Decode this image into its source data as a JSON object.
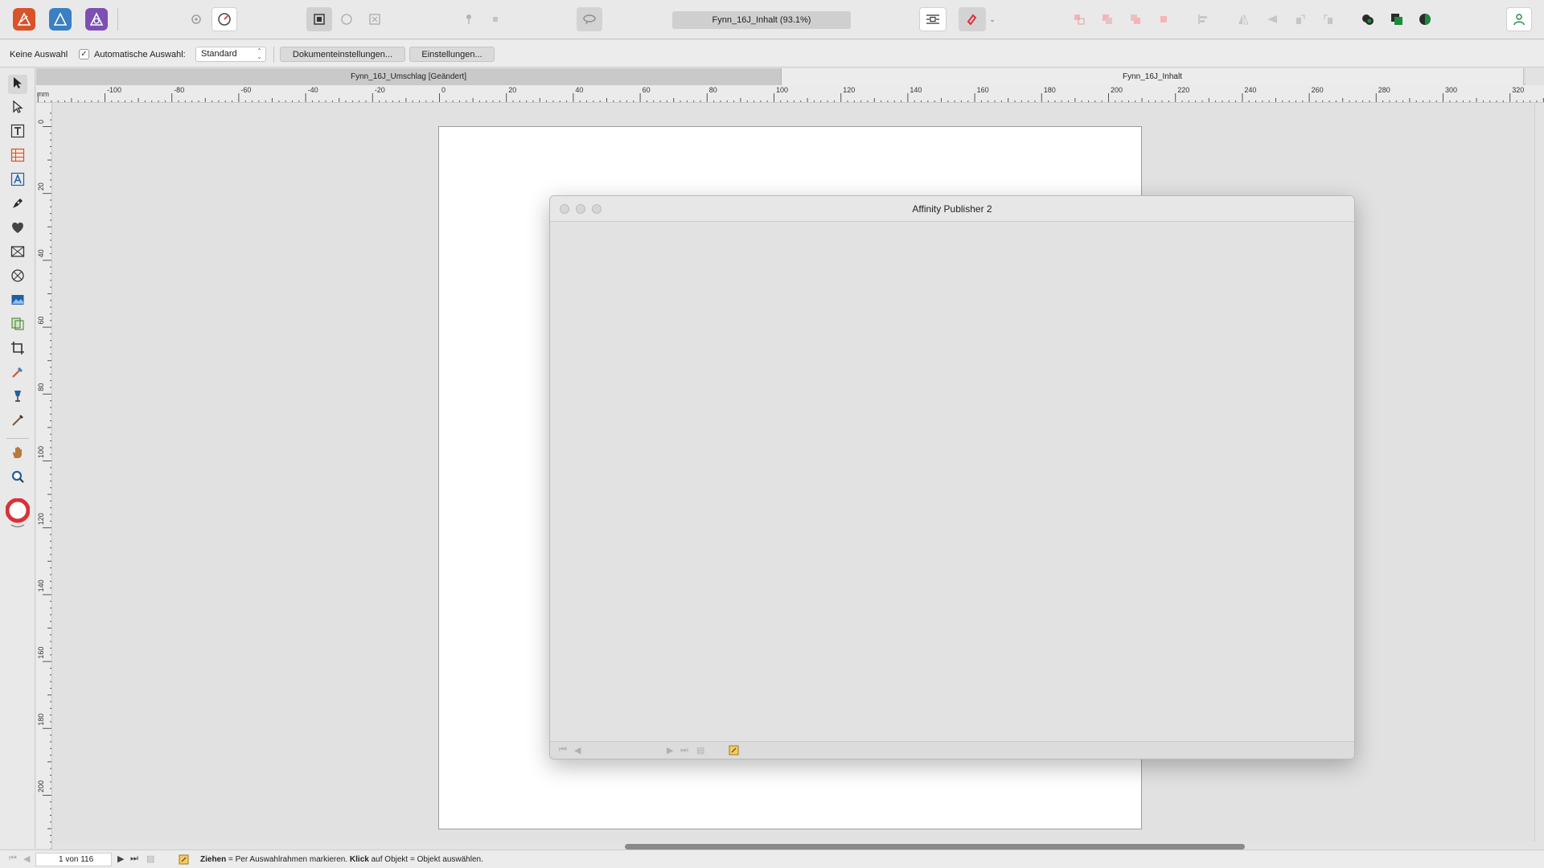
{
  "toolbar": {
    "document_title": "Fynn_16J_Inhalt (93.1%)",
    "apps": [
      "publisher-icon",
      "designer-icon",
      "photo-icon"
    ],
    "accent_colors": {
      "publisher": "#d9532a",
      "designer": "#3a7fc1",
      "photo": "#7d4fb3",
      "snap_red": "#d9323a",
      "persona_green": "#1e8a3c"
    }
  },
  "context": {
    "selection_label": "Keine Auswahl",
    "auto_select_label": "Automatische Auswahl:",
    "auto_select_checked": true,
    "auto_select_value": "Standard",
    "doc_settings_button": "Dokumenteinstellungen...",
    "settings_button": "Einstellungen..."
  },
  "tabs": [
    {
      "label": "Fynn_16J_Umschlag [Geändert]",
      "active": false
    },
    {
      "label": "Fynn_16J_Inhalt",
      "active": true
    }
  ],
  "ruler": {
    "unit": "mm",
    "h_labels": [
      "-100",
      "-80",
      "-60",
      "-40",
      "-20",
      "0",
      "20",
      "40",
      "60",
      "80",
      "100",
      "120",
      "140",
      "160",
      "180",
      "200",
      "220",
      "240",
      "260",
      "280",
      "300",
      "320"
    ],
    "v_labels": [
      "0",
      "20",
      "40",
      "60",
      "80",
      "100",
      "120",
      "140",
      "160",
      "180",
      "200"
    ]
  },
  "dialog": {
    "title": "Affinity Publisher 2"
  },
  "status": {
    "page_indicator": "1 von 116",
    "hint_drag_key": "Ziehen",
    "hint_drag_text": " = Per Auswahlrahmen markieren. ",
    "hint_click_key": "Klick",
    "hint_click_text": " auf Objekt = Objekt auswählen."
  }
}
